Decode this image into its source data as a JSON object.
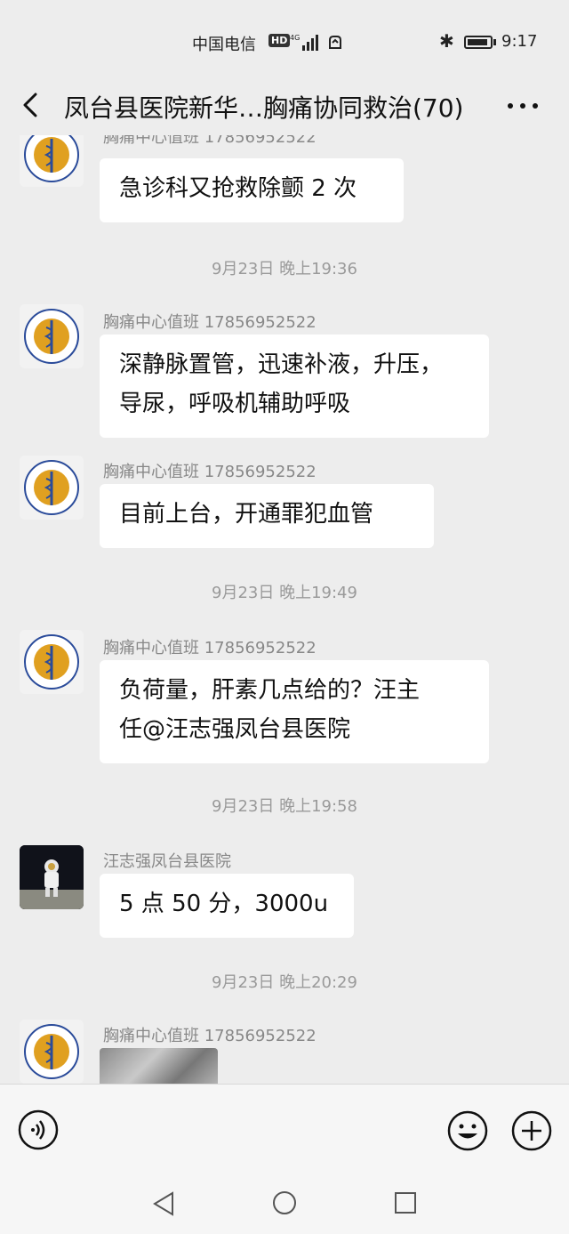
{
  "status_bar": {
    "carrier": "中国电信",
    "hd": "HD",
    "time": "9:17"
  },
  "header": {
    "title": "凤台县医院新华…胸痛协同救治(70)"
  },
  "messages": [
    {
      "sender": "胸痛中心值班 17856952522",
      "text": "急诊科又抢救除颤 2 次"
    },
    {
      "timestamp": "9月23日 晚上19:36"
    },
    {
      "sender": "胸痛中心值班 17856952522",
      "text_line1": "深静脉置管，迅速补液，升压，",
      "text_line2": "导尿，呼吸机辅助呼吸"
    },
    {
      "sender": "胸痛中心值班 17856952522",
      "text": "目前上台，开通罪犯血管"
    },
    {
      "timestamp": "9月23日 晚上19:49"
    },
    {
      "sender": "胸痛中心值班 17856952522",
      "text_line1": "负荷量，肝素几点给的？汪主",
      "text_line2": "任@汪志强凤台县医院"
    },
    {
      "timestamp": "9月23日 晚上19:58"
    },
    {
      "sender": "汪志强凤台县医院",
      "text": "5 点 50 分，3000u"
    },
    {
      "timestamp": "9月23日 晚上20:29"
    },
    {
      "sender": "胸痛中心值班 17856952522"
    }
  ],
  "colors": {
    "background": "#ededed",
    "bubble": "#ffffff",
    "avatar_accent": "#e0a020",
    "avatar_blue": "#2a4b9a"
  },
  "icons": {
    "back": "chevron-left-icon",
    "more": "more-icon",
    "voice": "voice-icon",
    "emoji": "emoji-icon",
    "plus": "plus-icon"
  }
}
